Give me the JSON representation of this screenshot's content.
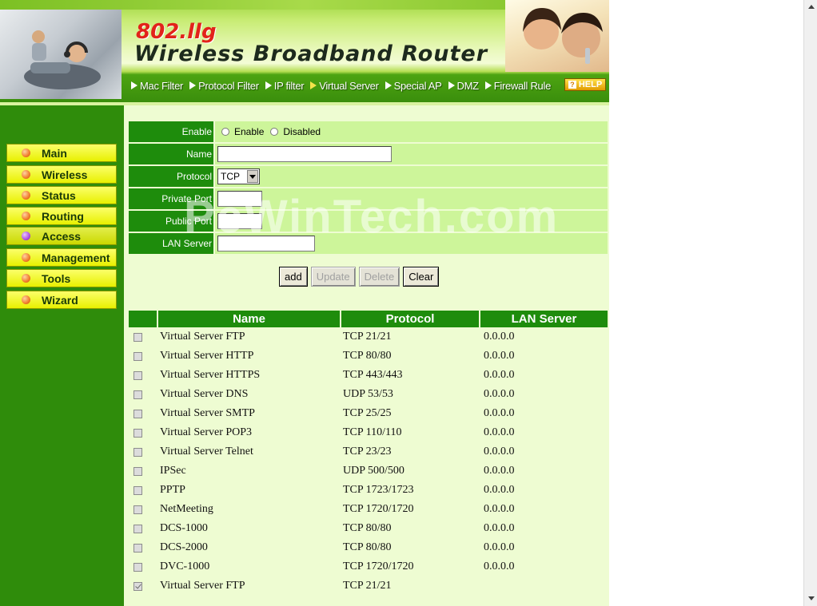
{
  "header": {
    "model": "802.llg",
    "title": "Wireless Broadband Router",
    "nav": [
      {
        "label": "Mac Filter",
        "active": false
      },
      {
        "label": "Protocol Filter",
        "active": false
      },
      {
        "label": "IP filter",
        "active": false
      },
      {
        "label": "Virtual Server",
        "active": true
      },
      {
        "label": "Special AP",
        "active": false
      },
      {
        "label": "DMZ",
        "active": false
      },
      {
        "label": "Firewall Rule",
        "active": false
      }
    ],
    "help_label": "HELP"
  },
  "sidebar": {
    "items": [
      {
        "label": "Main",
        "active": false
      },
      {
        "label": "Wireless",
        "active": false
      },
      {
        "label": "Status",
        "active": false
      },
      {
        "label": "Routing",
        "active": false
      },
      {
        "label": "Access",
        "active": true
      },
      {
        "label": "Management",
        "active": false
      },
      {
        "label": "Tools",
        "active": false
      },
      {
        "label": "Wizard",
        "active": false
      }
    ]
  },
  "form": {
    "enable_label": "Enable",
    "enable_option": "Enable",
    "disabled_option": "Disabled",
    "name_label": "Name",
    "name_value": "",
    "protocol_label": "Protocol",
    "protocol_value": "TCP",
    "private_port_label": "Private Port",
    "private_port_value": "",
    "public_port_label": "Public Port",
    "public_port_value": "",
    "lan_server_label": "LAN Server",
    "lan_server_value": ""
  },
  "buttons": {
    "add": "add",
    "update": "Update",
    "delete": "Delete",
    "clear": "Clear"
  },
  "watermark": "PcWinTech.com",
  "table": {
    "headers": [
      "Name",
      "Protocol",
      "LAN Server"
    ],
    "rows": [
      {
        "name": "Virtual Server FTP",
        "protocol": "TCP 21/21",
        "lan": "0.0.0.0",
        "checked": false
      },
      {
        "name": "Virtual Server HTTP",
        "protocol": "TCP 80/80",
        "lan": "0.0.0.0",
        "checked": false
      },
      {
        "name": "Virtual Server HTTPS",
        "protocol": "TCP 443/443",
        "lan": "0.0.0.0",
        "checked": false
      },
      {
        "name": "Virtual Server DNS",
        "protocol": "UDP 53/53",
        "lan": "0.0.0.0",
        "checked": false
      },
      {
        "name": "Virtual Server SMTP",
        "protocol": "TCP 25/25",
        "lan": "0.0.0.0",
        "checked": false
      },
      {
        "name": "Virtual Server POP3",
        "protocol": "TCP 110/110",
        "lan": "0.0.0.0",
        "checked": false
      },
      {
        "name": "Virtual Server Telnet",
        "protocol": "TCP 23/23",
        "lan": "0.0.0.0",
        "checked": false
      },
      {
        "name": "IPSec",
        "protocol": "UDP 500/500",
        "lan": "0.0.0.0",
        "checked": false
      },
      {
        "name": "PPTP",
        "protocol": "TCP 1723/1723",
        "lan": "0.0.0.0",
        "checked": false
      },
      {
        "name": "NetMeeting",
        "protocol": "TCP 1720/1720",
        "lan": "0.0.0.0",
        "checked": false
      },
      {
        "name": "DCS-1000",
        "protocol": "TCP 80/80",
        "lan": "0.0.0.0",
        "checked": false
      },
      {
        "name": "DCS-2000",
        "protocol": "TCP 80/80",
        "lan": "0.0.0.0",
        "checked": false
      },
      {
        "name": "DVC-1000",
        "protocol": "TCP 1720/1720",
        "lan": "0.0.0.0",
        "checked": false
      },
      {
        "name": "Virtual Server FTP",
        "protocol": "TCP 21/21",
        "lan": "",
        "checked": true
      }
    ]
  }
}
